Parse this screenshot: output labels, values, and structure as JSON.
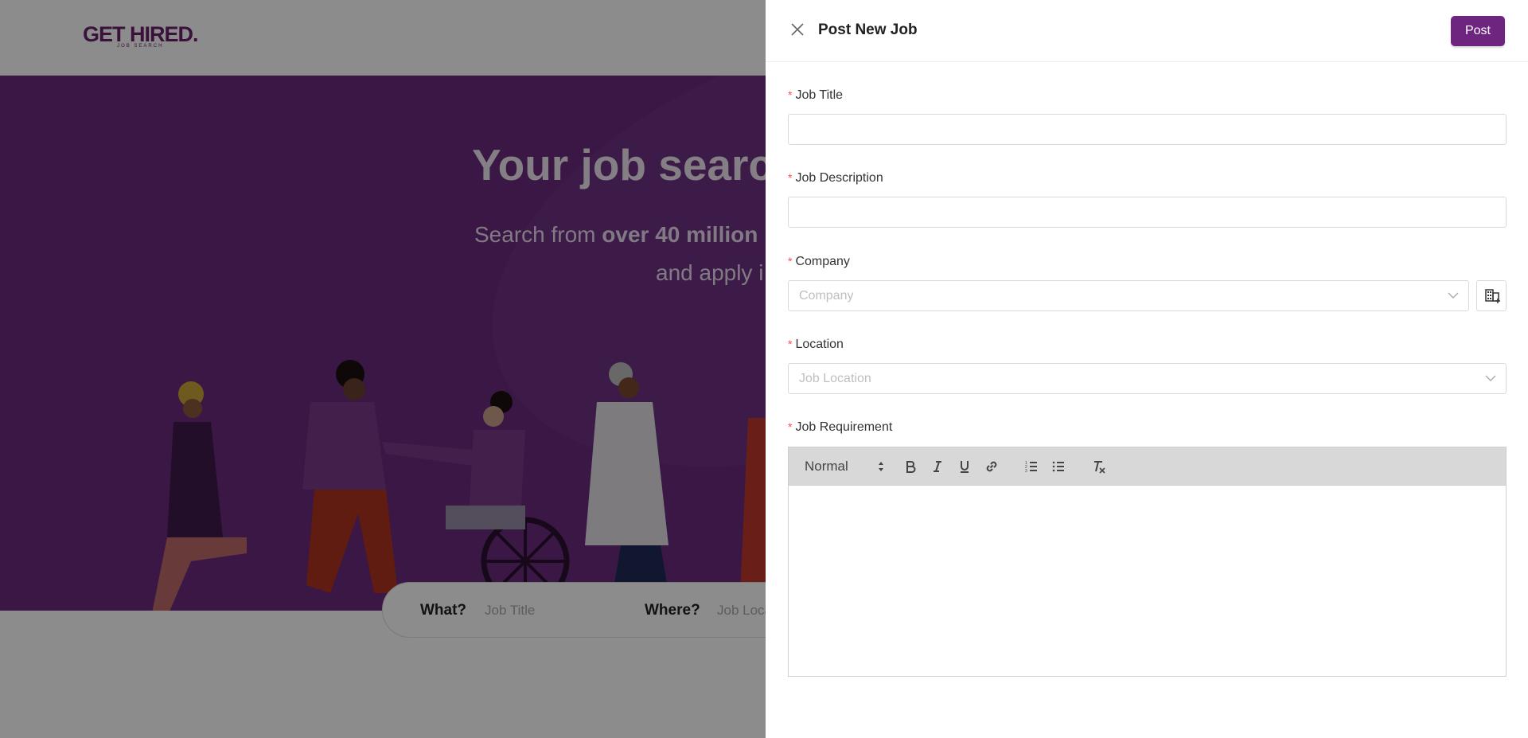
{
  "background": {
    "logo": {
      "main": "GET HIRED.",
      "sub": "JOB SEARCH"
    },
    "hero": {
      "title": "Your job searc",
      "subtitle_pre": "Search from ",
      "subtitle_bold": "over 40 million",
      "subtitle_line2": "and apply i"
    },
    "search": {
      "what_label": "What?",
      "what_placeholder": "Job Title",
      "where_label": "Where?",
      "where_placeholder": "Job Loca"
    }
  },
  "drawer": {
    "title": "Post New Job",
    "post_label": "Post",
    "fields": {
      "job_title": {
        "label": "Job Title",
        "value": ""
      },
      "job_description": {
        "label": "Job Description",
        "value": ""
      },
      "company": {
        "label": "Company",
        "placeholder": "Company"
      },
      "location": {
        "label": "Location",
        "placeholder": "Job Location"
      },
      "job_requirement": {
        "label": "Job Requirement"
      }
    },
    "required_marker": "*",
    "editor": {
      "format_value": "Normal",
      "tools": [
        "bold-icon",
        "italic-icon",
        "underline-icon",
        "link-icon",
        "ordered-list-icon",
        "bullet-list-icon",
        "clear-format-icon"
      ]
    }
  },
  "colors": {
    "brand": "#6d2580",
    "required": "#ff4d4f",
    "hero_bg": "#6a2a7e"
  }
}
